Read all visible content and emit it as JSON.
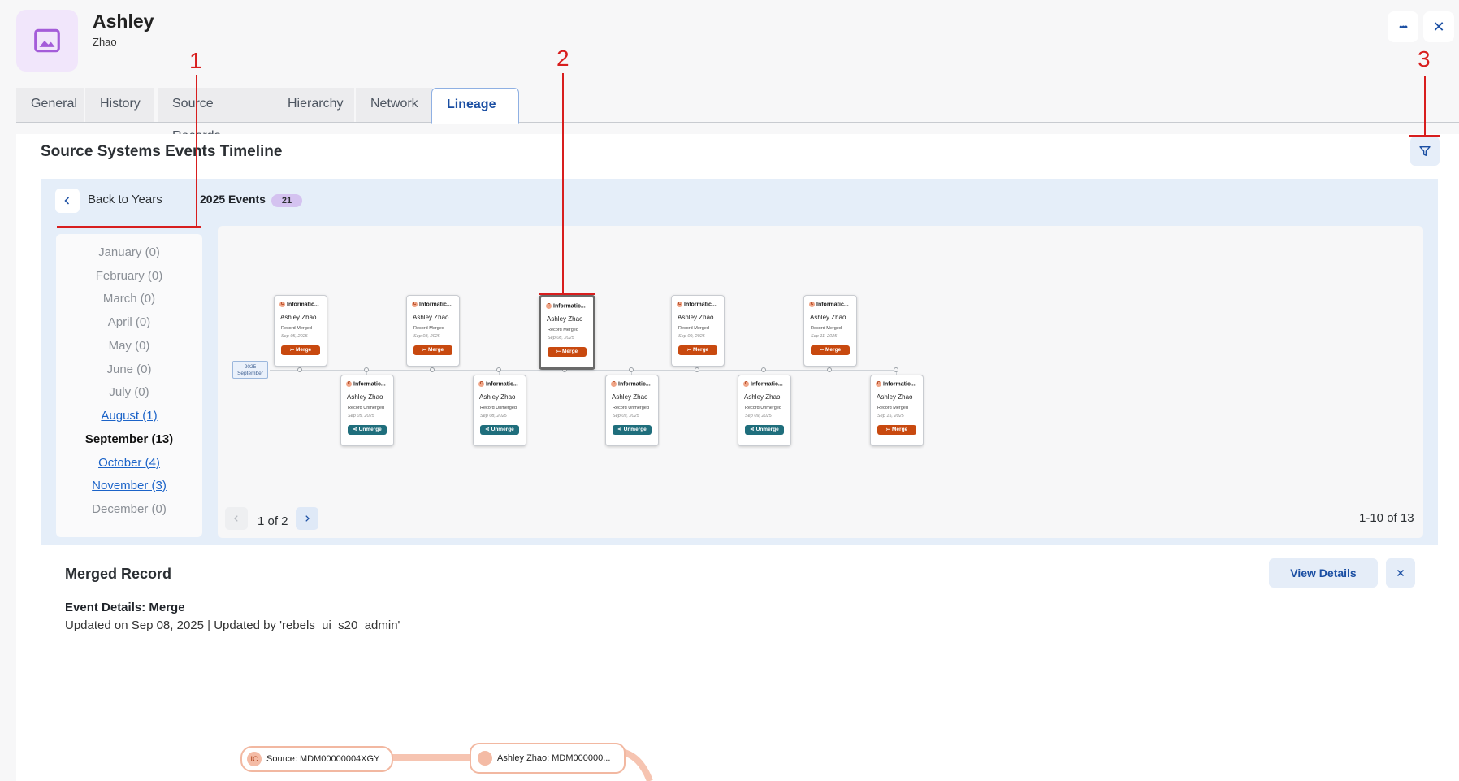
{
  "header": {
    "title": "Ashley",
    "subtitle": "Zhao",
    "more_glyph": "•••",
    "close_glyph": "✕"
  },
  "tabs": [
    {
      "label": "General"
    },
    {
      "label": "History"
    },
    {
      "label": "Source Records"
    },
    {
      "label": "Hierarchy"
    },
    {
      "label": "Network"
    },
    {
      "label": "Lineage",
      "active": true
    }
  ],
  "timeline": {
    "title": "Source Systems Events Timeline",
    "back_label": "Back to Years",
    "events_label": "2025 Events",
    "events_count": "21",
    "months": [
      {
        "label": "January (0)",
        "state": "disabled"
      },
      {
        "label": "February (0)",
        "state": "disabled"
      },
      {
        "label": "March (0)",
        "state": "disabled"
      },
      {
        "label": "April (0)",
        "state": "disabled"
      },
      {
        "label": "May (0)",
        "state": "disabled"
      },
      {
        "label": "June (0)",
        "state": "disabled"
      },
      {
        "label": "July (0)",
        "state": "disabled"
      },
      {
        "label": "August (1)",
        "state": "link"
      },
      {
        "label": "September (13)",
        "state": "current"
      },
      {
        "label": "October (4)",
        "state": "link"
      },
      {
        "label": "November (3)",
        "state": "link"
      },
      {
        "label": "December (0)",
        "state": "disabled"
      }
    ],
    "axis_label_year": "2025",
    "axis_label_month": "September",
    "cards": [
      {
        "source": "Informatic...",
        "name": "Ashley Zhao",
        "action": "Record Merged",
        "date": "Sep 05, 2025",
        "tag": "Merge"
      },
      {
        "source": "Informatic...",
        "name": "Ashley Zhao",
        "action": "Record Unmerged",
        "date": "Sep 05, 2025",
        "tag": "Unmerge"
      },
      {
        "source": "Informatic...",
        "name": "Ashley Zhao",
        "action": "Record Merged",
        "date": "Sep 08, 2025",
        "tag": "Merge"
      },
      {
        "source": "Informatic...",
        "name": "Ashley Zhao",
        "action": "Record Unmerged",
        "date": "Sep 08, 2025",
        "tag": "Unmerge"
      },
      {
        "source": "Informatic...",
        "name": "Ashley Zhao",
        "action": "Record Merged",
        "date": "Sep 08, 2025",
        "tag": "Merge",
        "selected": true
      },
      {
        "source": "Informatic...",
        "name": "Ashley Zhao",
        "action": "Record Unmerged",
        "date": "Sep 09, 2025",
        "tag": "Unmerge"
      },
      {
        "source": "Informatic...",
        "name": "Ashley Zhao",
        "action": "Record Merged",
        "date": "Sep 09, 2025",
        "tag": "Merge"
      },
      {
        "source": "Informatic...",
        "name": "Ashley Zhao",
        "action": "Record Unmerged",
        "date": "Sep 09, 2025",
        "tag": "Unmerge"
      },
      {
        "source": "Informatic...",
        "name": "Ashley Zhao",
        "action": "Record Merged",
        "date": "Sep 11, 2025",
        "tag": "Merge"
      },
      {
        "source": "Informatic...",
        "name": "Ashley Zhao",
        "action": "Record Merged",
        "date": "Sep 15, 2025",
        "tag": "Merge"
      }
    ],
    "pagination": {
      "label": "1 of 2",
      "range": "1-10 of 13"
    }
  },
  "details": {
    "title": "Merged Record",
    "view_label": "View Details",
    "event_label": "Event Details: Merge",
    "updated": "Updated on Sep 08, 2025 | Updated by 'rebels_ui_s20_admin'"
  },
  "lineage": {
    "source_badge": "IC",
    "source_node": "Source: MDM00000004XGY",
    "target_node": "Ashley Zhao: MDM000000..."
  },
  "annotations": [
    "1",
    "2",
    "3"
  ],
  "colors": {
    "accent": "#1b4fa3",
    "merge": "#c8490f",
    "unmerge": "#1f6e7c",
    "annotation": "#d81e1e"
  }
}
